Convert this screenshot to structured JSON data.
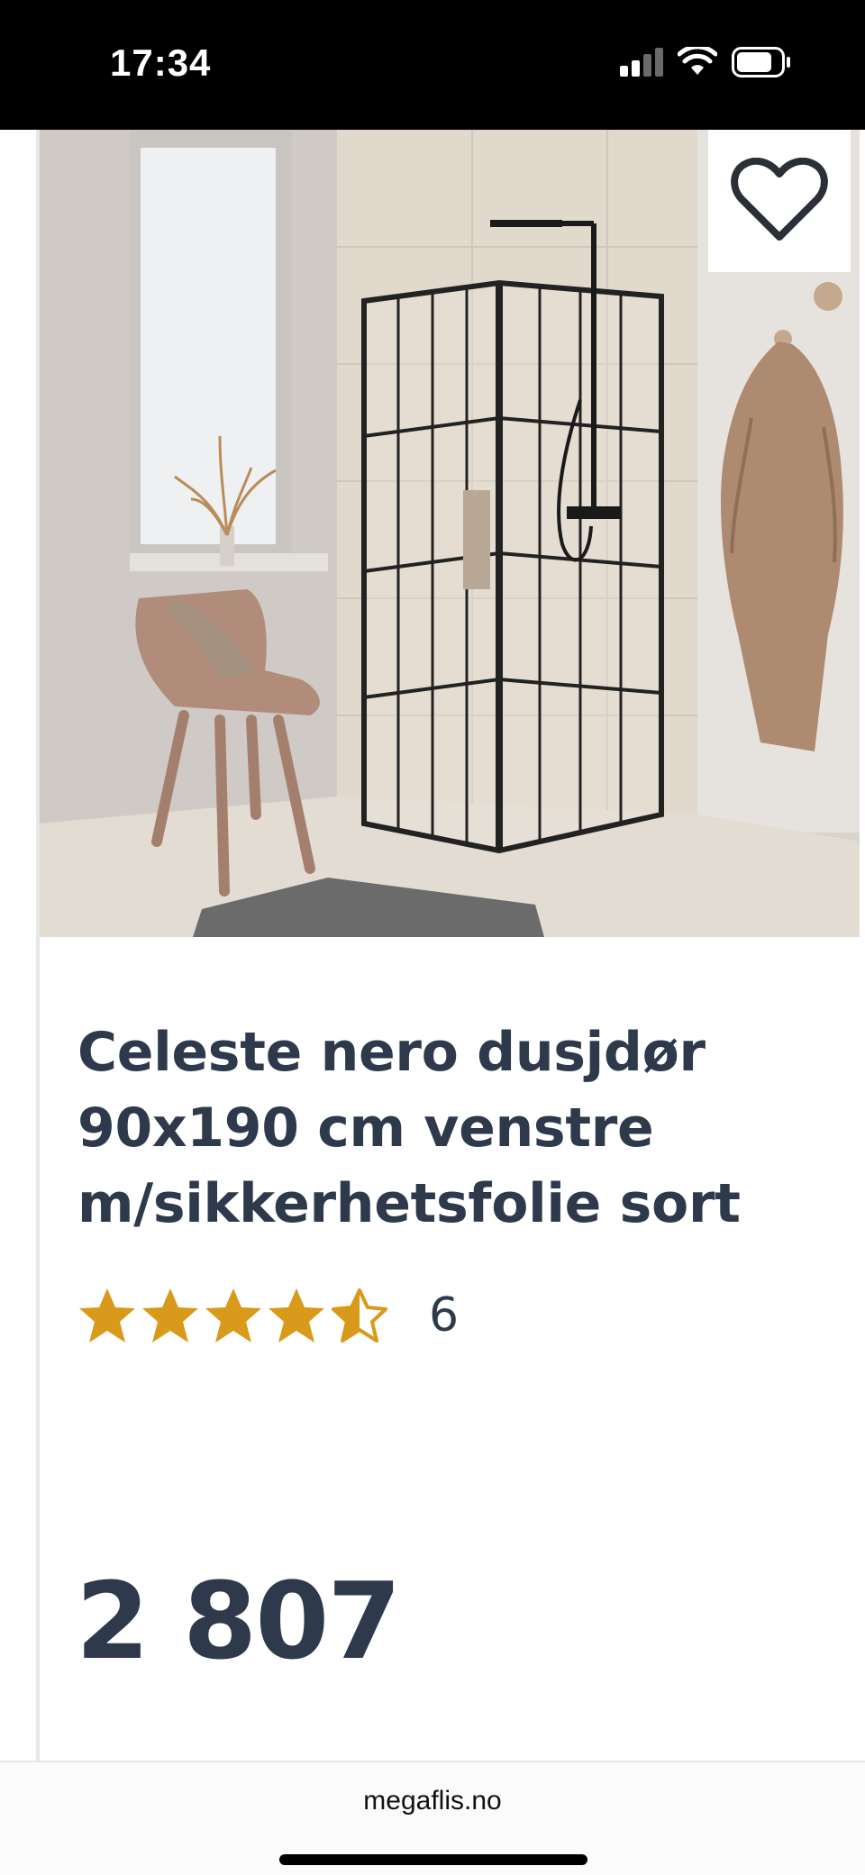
{
  "status_bar": {
    "time": "17:34",
    "icons": [
      "cellular-signal-icon",
      "wifi-icon",
      "battery-icon"
    ]
  },
  "product": {
    "image_icon": "shower-enclosure-photo",
    "favorite_icon": "heart-outline-icon",
    "title": "Celeste nero dusjdør 90x190 cm venstre m/sikkerhetsfolie sort",
    "rating": 4.5,
    "stars_max": 5,
    "review_count": "6",
    "price": "2 807"
  },
  "browser": {
    "url": "megaflis.no"
  },
  "colors": {
    "text": "#2e3a4b",
    "star": "#d9991a",
    "status_bar_bg": "#000000"
  }
}
